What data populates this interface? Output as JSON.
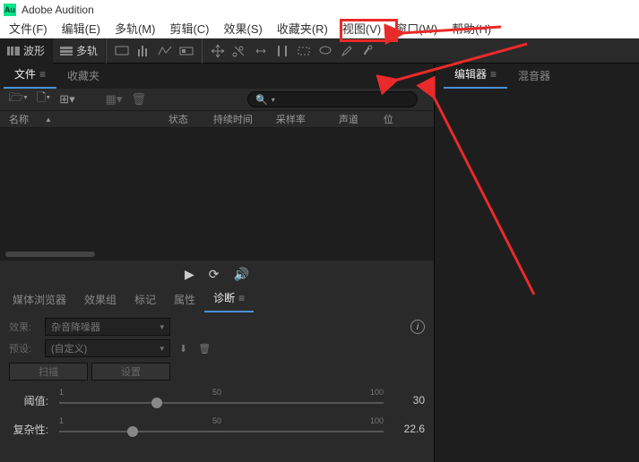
{
  "app": {
    "title": "Adobe Audition",
    "iconText": "Au"
  },
  "menu": {
    "items": [
      "文件(F)",
      "编辑(E)",
      "多轨(M)",
      "剪辑(C)",
      "效果(S)",
      "收藏夹(R)",
      "视图(V)",
      "窗口(W)",
      "帮助(H)"
    ]
  },
  "modes": {
    "waveform": "波形",
    "multitrack": "多轨"
  },
  "filesPanel": {
    "tabs": {
      "files": "文件",
      "favorites": "收藏夹"
    },
    "search": {
      "placeholder": "ρ▾"
    },
    "headers": {
      "name": "名称",
      "status": "状态",
      "duration": "持续时间",
      "sampleRate": "采样率",
      "channel": "声道",
      "bitDepth": "位"
    }
  },
  "lowerPanel": {
    "tabs": {
      "mediaBrowser": "媒体浏览器",
      "effectsRack": "效果组",
      "markers": "标记",
      "properties": "属性",
      "diagnostics": "诊断"
    },
    "diag": {
      "effectLabel": "效果:",
      "effectValue": "杂音降噪器",
      "presetLabel": "预设:",
      "presetValue": "(自定义)",
      "scan": "扫描",
      "settings": "设置",
      "threshold": {
        "label": "阈值:",
        "min": "1",
        "mid": "50",
        "max": "100",
        "value": "30"
      },
      "complexity": {
        "label": "复杂性:",
        "min": "1",
        "mid": "50",
        "max": "100",
        "value": "22.6"
      }
    }
  },
  "rightPanel": {
    "tabs": {
      "editor": "编辑器",
      "mixer": "混音器"
    }
  }
}
